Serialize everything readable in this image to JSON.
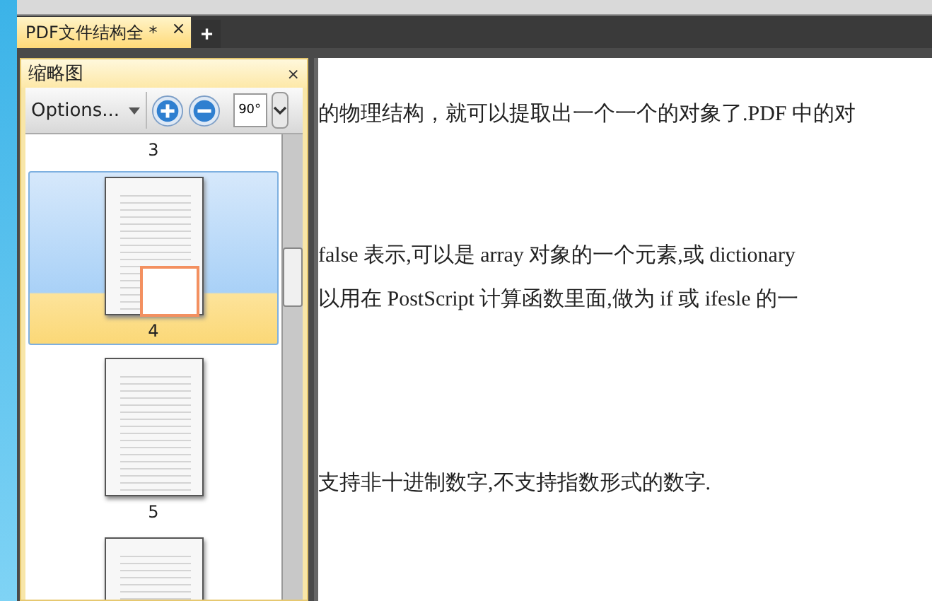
{
  "tabs": [
    {
      "label": "PDF文件结构全 *",
      "selected": true,
      "close": "×"
    }
  ],
  "new_tab": "+",
  "panel": {
    "title": "缩略图",
    "close": "×",
    "options": "Options...",
    "rotate": "90°",
    "thumbnails": [
      {
        "label": "3",
        "selected": false,
        "preview_shown": false
      },
      {
        "label": "4",
        "selected": true,
        "preview_shown": true
      },
      {
        "label": "5",
        "selected": false,
        "preview_shown": true
      },
      {
        "selected": false,
        "preview_shown": true
      }
    ]
  },
  "document": {
    "paragraphs": [
      [
        "的物理结构，就可以提取出一个一个的对象了.PDF 中的对"
      ],
      [
        "false 表示,可以是 array 对象的一个元素,或 dictionary",
        "以用在 PostScript 计算函数里面,做为 if 或 ifesle 的一"
      ],
      [
        "支持非十进制数字,不支持指数形式的数字."
      ]
    ]
  }
}
